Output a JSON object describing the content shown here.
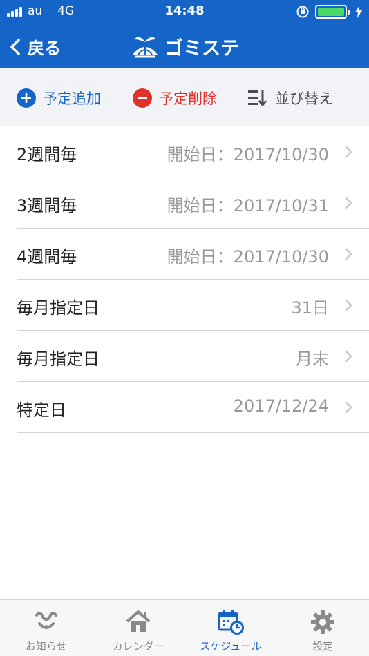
{
  "status_bar": {
    "carrier": "au",
    "network": "4G",
    "time": "14:48"
  },
  "nav": {
    "back_label": "戻る",
    "title": "ゴミステ"
  },
  "toolbar": {
    "add_label": "予定追加",
    "delete_label": "予定削除",
    "sort_label": "並び替え"
  },
  "schedule": {
    "items": [
      {
        "label": "2週間毎",
        "value": "開始日：2017/10/30"
      },
      {
        "label": "3週間毎",
        "value": "開始日：2017/10/31"
      },
      {
        "label": "4週間毎",
        "value": "開始日：2017/10/30"
      },
      {
        "label": "毎月指定日",
        "value": "31日"
      },
      {
        "label": "毎月指定日",
        "value": "月末"
      },
      {
        "label": "特定日",
        "value": "2017/12/24"
      }
    ]
  },
  "tabs": {
    "items": [
      {
        "label": "お知らせ",
        "icon": "notification-icon"
      },
      {
        "label": "カレンダー",
        "icon": "home-icon"
      },
      {
        "label": "スケジュール",
        "icon": "calendar-clock-icon"
      },
      {
        "label": "設定",
        "icon": "gear-icon"
      }
    ],
    "active": "スケジュール"
  },
  "colors": {
    "brand": "#1565c8",
    "delete": "#e0322c",
    "battery": "#4cd964"
  }
}
